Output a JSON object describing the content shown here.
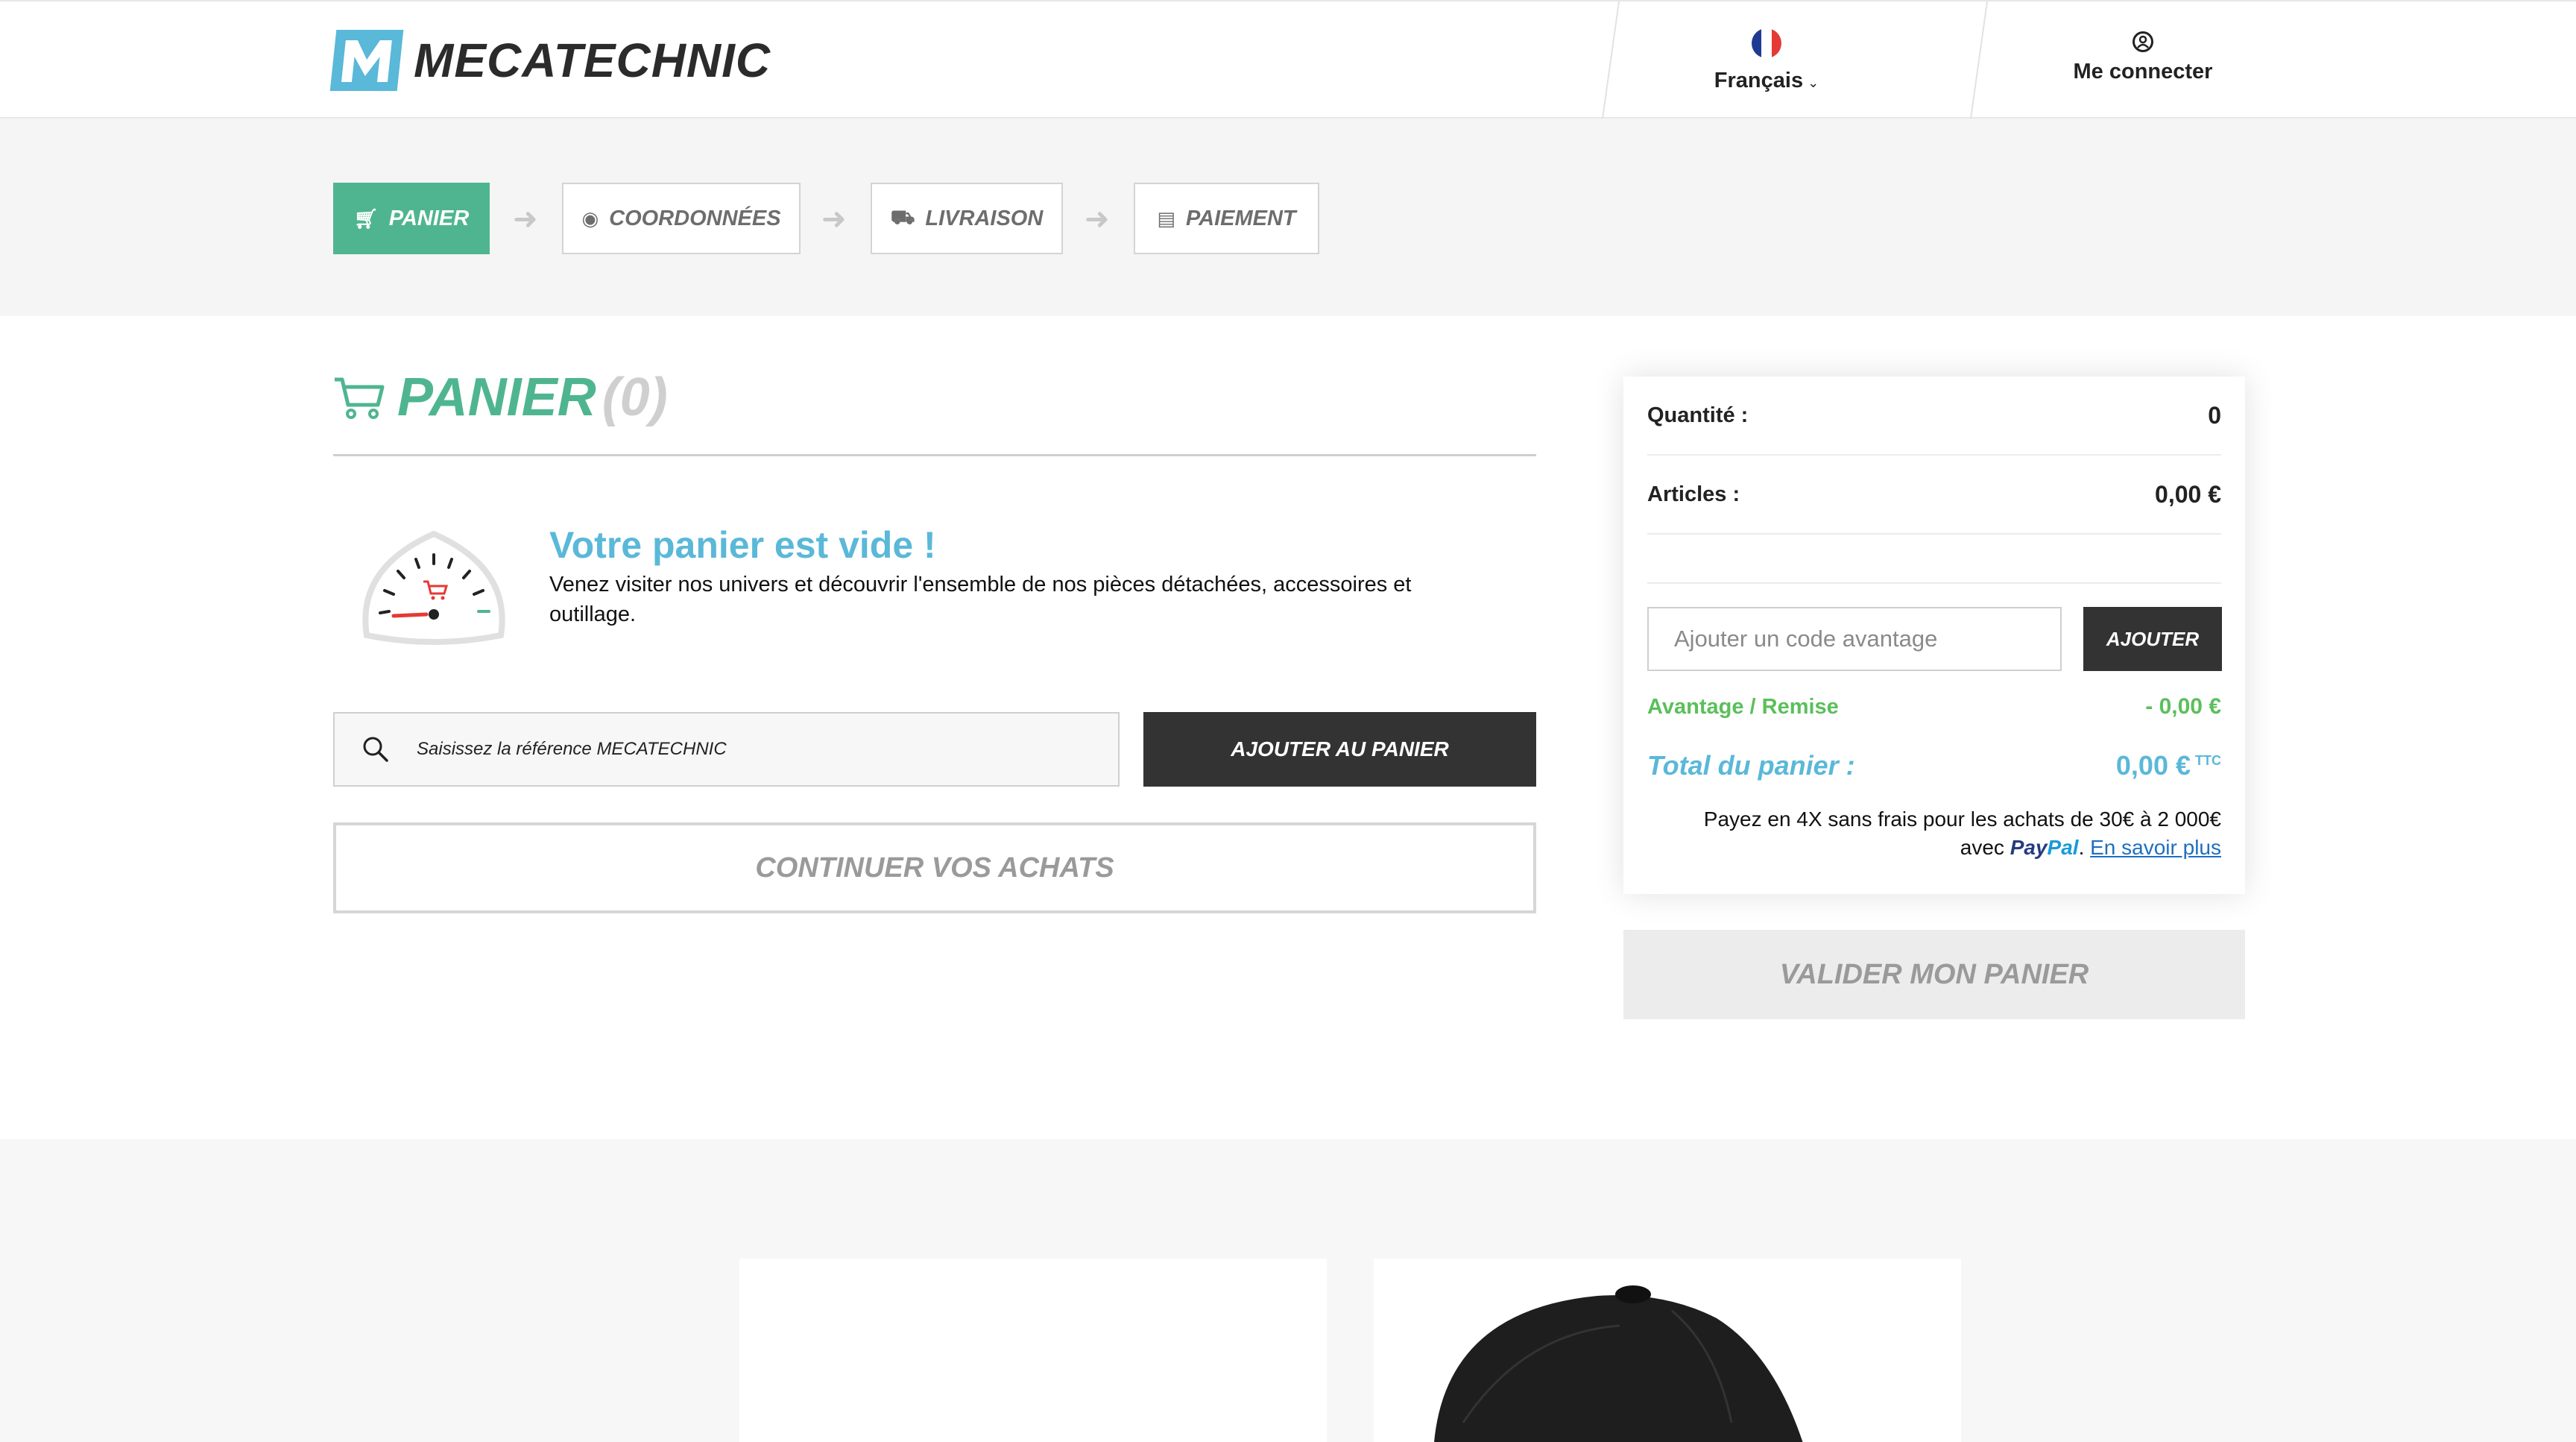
{
  "brand": {
    "name": "MECATECHNIC",
    "accent": "#4fb590",
    "blue": "#5ab8d8"
  },
  "header": {
    "language": {
      "label": "Français",
      "flag": "fr-flag-icon"
    },
    "login": {
      "label": "Me connecter"
    }
  },
  "steps": [
    {
      "label": "PANIER",
      "icon": "cart-icon",
      "active": true
    },
    {
      "label": "COORDONNÉES",
      "icon": "user-icon",
      "active": false
    },
    {
      "label": "LIVRAISON",
      "icon": "truck-icon",
      "active": false
    },
    {
      "label": "PAIEMENT",
      "icon": "payment-icon",
      "active": false
    }
  ],
  "cart": {
    "title": "PANIER",
    "count": "(0)",
    "empty_title": "Votre panier est vide !",
    "empty_text": "Venez visiter nos univers et découvrir l'ensemble de nos pièces détachées, accessoires et outillage.",
    "ref_placeholder": "Saisissez la référence MECATECHNIC",
    "add_to_cart": "AJOUTER AU PANIER",
    "continue": "CONTINUER VOS ACHATS"
  },
  "summary": {
    "quantity_label": "Quantité :",
    "quantity_value": "0",
    "articles_label": "Articles :",
    "articles_value": "0,00 €",
    "code_placeholder": "Ajouter un code avantage",
    "apply": "AJOUTER",
    "discount_label": "Avantage / Remise",
    "discount_value": "- 0,00 €",
    "total_label": "Total du panier :",
    "total_value": "0,00 €",
    "total_suffix": "TTC",
    "paypal_line1": "Payez en 4X sans frais pour les achats de 30€ à 2 000€",
    "paypal_avec": "avec",
    "paypal_brand_1": "Pay",
    "paypal_brand_2": "Pal",
    "paypal_link": "En savoir plus",
    "validate": "VALIDER MON PANIER"
  }
}
